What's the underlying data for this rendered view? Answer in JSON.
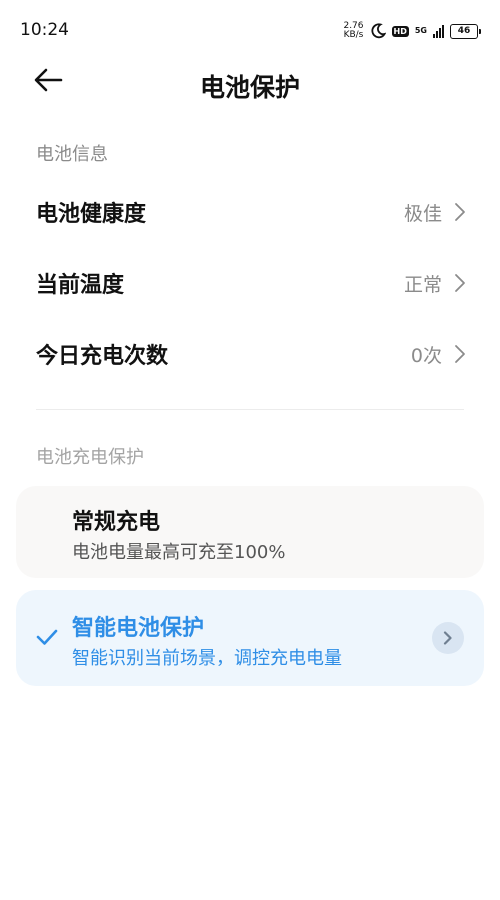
{
  "status_bar": {
    "time": "10:24",
    "net_speed_value": "2.76",
    "net_speed_unit": "KB/s",
    "hd_label": "HD",
    "network_label": "5G",
    "battery_level": "46",
    "icons": [
      "moon-icon",
      "hd-icon",
      "signal-icon",
      "battery-icon"
    ]
  },
  "header": {
    "title": "电池保护",
    "back_icon": "arrow-left-icon"
  },
  "battery_info": {
    "section_label": "电池信息",
    "rows": [
      {
        "label": "电池健康度",
        "value": "极佳"
      },
      {
        "label": "当前温度",
        "value": "正常"
      },
      {
        "label": "今日充电次数",
        "value": "0次"
      }
    ]
  },
  "charge_protection": {
    "section_label": "电池充电保护",
    "options": [
      {
        "title": "常规充电",
        "desc": "电池电量最高可充至100%",
        "selected": false
      },
      {
        "title": "智能电池保护",
        "desc": "智能识别当前场景，调控充电电量",
        "selected": true
      }
    ]
  },
  "colors": {
    "accent": "#2f8ee6",
    "secondary_text": "#8b8b8b",
    "selected_card_bg": "#eef6fd",
    "normal_card_bg": "#f9f8f7"
  }
}
